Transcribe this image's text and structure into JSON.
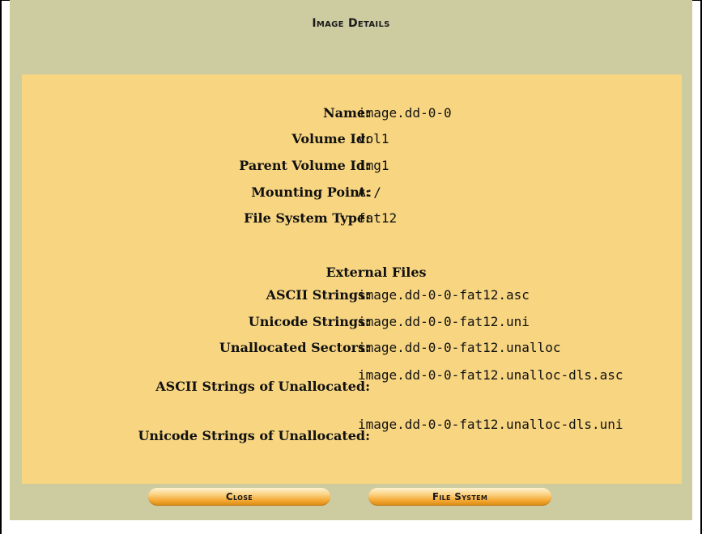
{
  "title": "Image Details",
  "details": [
    {
      "label": "Name:",
      "value": "image.dd-0-0"
    },
    {
      "label": "Volume Id:",
      "value": "vol1"
    },
    {
      "label": "Parent Volume Id:",
      "value": "img1"
    },
    {
      "label": "Mounting Point:",
      "value": "A:/"
    },
    {
      "label": "File System Type:",
      "value": "fat12"
    }
  ],
  "external_files": {
    "heading": "External Files",
    "items": [
      {
        "label": "ASCII Strings:",
        "value": "image.dd-0-0-fat12.asc"
      },
      {
        "label": "Unicode Strings:",
        "value": "image.dd-0-0-fat12.uni"
      },
      {
        "label": "Unallocated Sectors:",
        "value": "image.dd-0-0-fat12.unalloc"
      },
      {
        "label": "ASCII Strings of Unallocated:",
        "value": "image.dd-0-0-fat12.unalloc-dls.asc"
      },
      {
        "label": "Unicode Strings of Unallocated:",
        "value": "image.dd-0-0-fat12.unalloc-dls.uni"
      }
    ]
  },
  "buttons": {
    "close": "Close",
    "file_system": "File System"
  },
  "colors": {
    "panel": "#cdcca1",
    "details_bg": "#f7d581",
    "button": "#f5a934"
  }
}
